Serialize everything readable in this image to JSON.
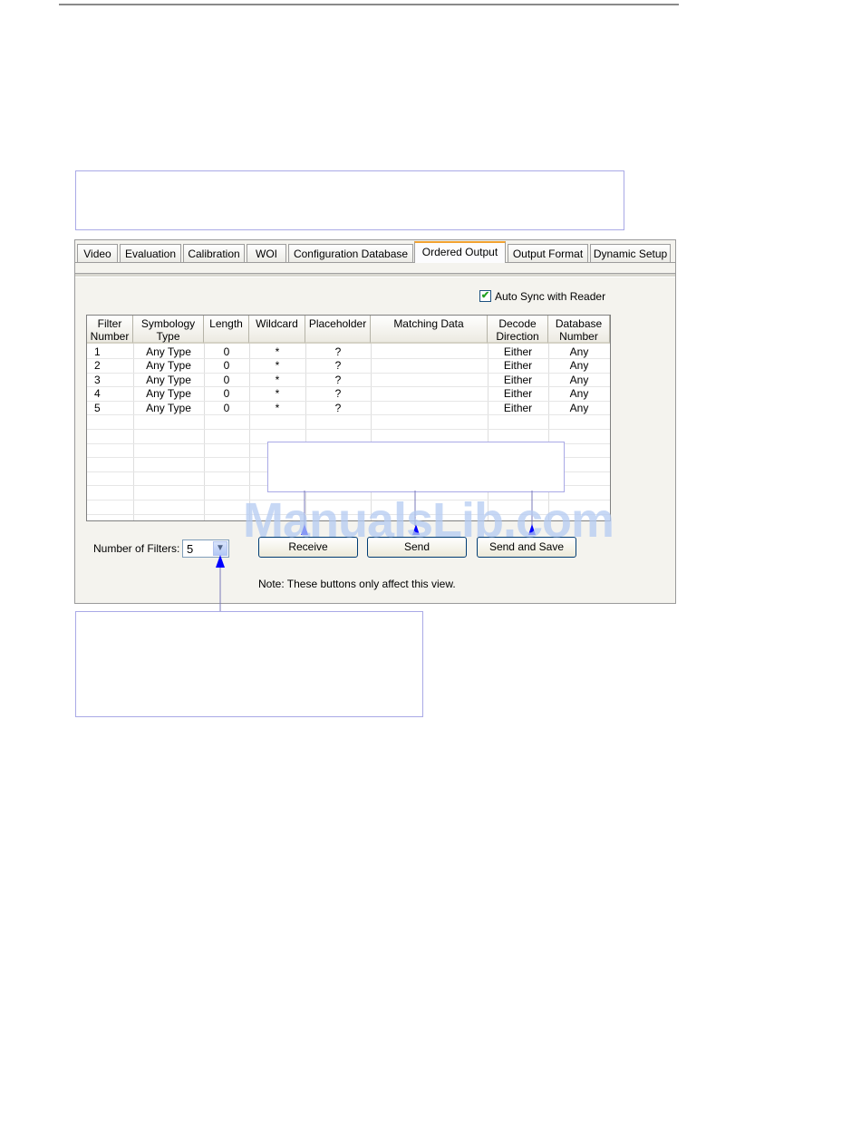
{
  "tabs": [
    "Video",
    "Evaluation",
    "Calibration",
    "WOI",
    "Configuration Database",
    "Ordered Output",
    "Output Format",
    "Dynamic Setup"
  ],
  "active_tab": "Ordered Output",
  "auto_sync": {
    "label": "Auto Sync with Reader",
    "checked": true,
    "check_glyph": "✔"
  },
  "table": {
    "headers": [
      [
        "Filter",
        "Number"
      ],
      [
        "Symbology",
        "Type"
      ],
      [
        "Length",
        ""
      ],
      [
        "Wildcard",
        ""
      ],
      [
        "Placeholder",
        ""
      ],
      [
        "Matching Data",
        ""
      ],
      [
        "Decode",
        "Direction"
      ],
      [
        "Database",
        "Number"
      ]
    ],
    "rows": [
      [
        "1",
        "Any Type",
        "0",
        "*",
        "?",
        "",
        "Either",
        "Any"
      ],
      [
        "2",
        "Any Type",
        "0",
        "*",
        "?",
        "",
        "Either",
        "Any"
      ],
      [
        "3",
        "Any Type",
        "0",
        "*",
        "?",
        "",
        "Either",
        "Any"
      ],
      [
        "4",
        "Any Type",
        "0",
        "*",
        "?",
        "",
        "Either",
        "Any"
      ],
      [
        "5",
        "Any Type",
        "0",
        "*",
        "?",
        "",
        "Either",
        "Any"
      ]
    ]
  },
  "number_of_filters": {
    "label": "Number of Filters:",
    "value": "5",
    "icon": "chevron-down-icon"
  },
  "buttons": {
    "receive": "Receive",
    "send": "Send",
    "send_and_save": "Send and Save"
  },
  "note": "Note: These buttons only affect this view.",
  "watermark": "ManualsLib.com",
  "colors": {
    "tab_highlight": "#f2a230",
    "callout_border": "#a9a9e6",
    "arrow": "#0000ff"
  }
}
